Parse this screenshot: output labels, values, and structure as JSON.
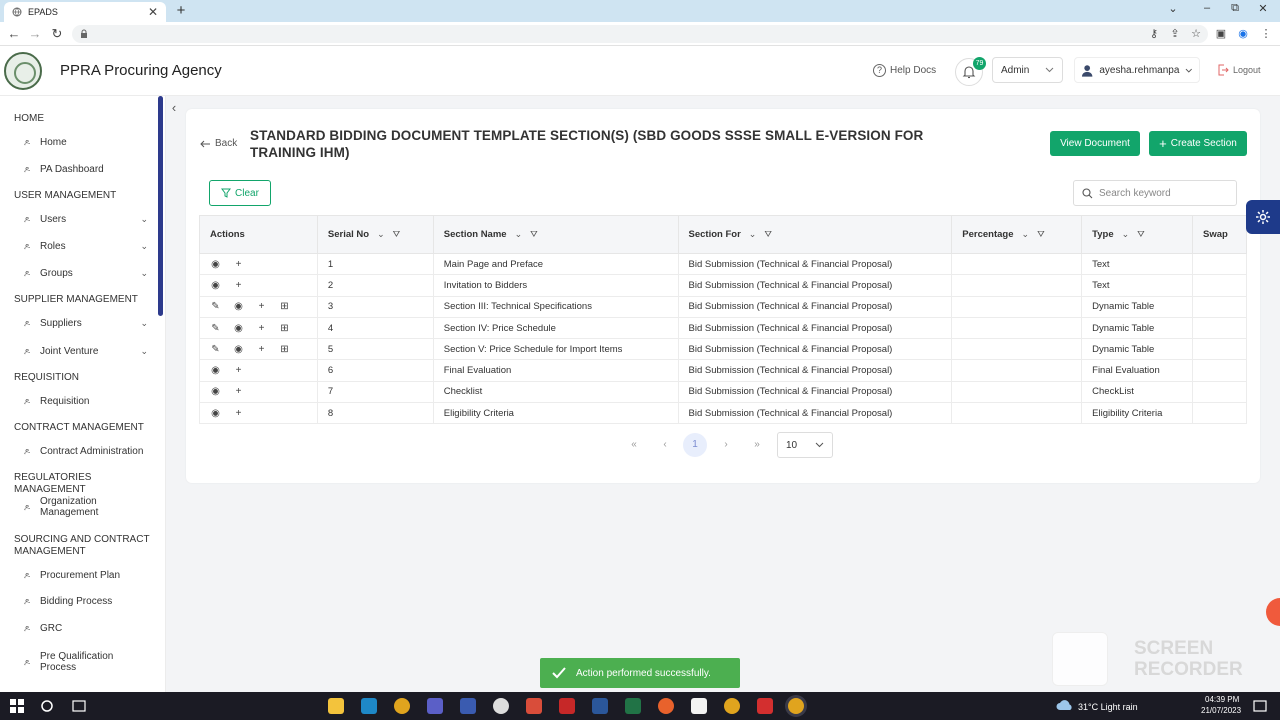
{
  "browser": {
    "tab_title": "EPADS",
    "close_glyph": "✕",
    "newtab_glyph": "+",
    "win_controls": [
      "⌄",
      "–",
      "⧉",
      "✕"
    ],
    "nav_icons": [
      "←",
      "→",
      "↻"
    ],
    "address_icons": [
      "⚷",
      "⇪",
      "☆",
      "▣",
      "◉",
      "⋮"
    ]
  },
  "header": {
    "agency": "PPRA Procuring Agency",
    "help_label": "Help Docs",
    "notification_count": "79",
    "role": "Admin",
    "user": "ayesha.rehmanpa",
    "logout": "Logout"
  },
  "sidebar": {
    "sections": [
      {
        "label": "HOME"
      },
      {
        "label": "USER MANAGEMENT"
      },
      {
        "label": "SUPPLIER MANAGEMENT"
      },
      {
        "label": "REQUISITION"
      },
      {
        "label": "CONTRACT MANAGEMENT"
      },
      {
        "label": "REGULATORIES MANAGEMENT"
      },
      {
        "label": "SOURCING AND CONTRACT MANAGEMENT"
      }
    ],
    "items": [
      {
        "label": "Home"
      },
      {
        "label": "PA Dashboard"
      },
      {
        "label": "Users"
      },
      {
        "label": "Roles"
      },
      {
        "label": "Groups"
      },
      {
        "label": "Suppliers"
      },
      {
        "label": "Joint Venture"
      },
      {
        "label": "Requisition"
      },
      {
        "label": "Contract Administration"
      },
      {
        "label": "Organization Management"
      },
      {
        "label": "Procurement Plan"
      },
      {
        "label": "Bidding Process"
      },
      {
        "label": "GRC"
      },
      {
        "label": "Pre Qualification Process"
      }
    ]
  },
  "page": {
    "back": "Back",
    "title": "STANDARD BIDDING DOCUMENT TEMPLATE SECTION(S) (SBD GOODS SSSE SMALL E-VERSION FOR TRAINING IHM)",
    "view_document": "View Document",
    "create_section": "Create Section",
    "clear": "Clear",
    "search_placeholder": "Search keyword"
  },
  "table": {
    "headers": [
      "Actions",
      "Serial No",
      "Section Name",
      "Section For",
      "Percentage",
      "Type",
      "Swap"
    ],
    "rows": [
      {
        "serial": "1",
        "name": "Main Page and Preface",
        "for": "Bid Submission (Technical & Financial Proposal)",
        "percentage": "",
        "type": "Text"
      },
      {
        "serial": "2",
        "name": "Invitation to Bidders",
        "for": "Bid Submission (Technical & Financial Proposal)",
        "percentage": "",
        "type": "Text"
      },
      {
        "serial": "3",
        "name": "Section III: Technical Specifications",
        "for": "Bid Submission (Technical & Financial Proposal)",
        "percentage": "",
        "type": "Dynamic Table"
      },
      {
        "serial": "4",
        "name": "Section IV: Price Schedule",
        "for": "Bid Submission (Technical & Financial Proposal)",
        "percentage": "",
        "type": "Dynamic Table"
      },
      {
        "serial": "5",
        "name": "Section V: Price Schedule for Import Items",
        "for": "Bid Submission (Technical & Financial Proposal)",
        "percentage": "",
        "type": "Dynamic Table"
      },
      {
        "serial": "6",
        "name": "Final Evaluation",
        "for": "Bid Submission (Technical & Financial Proposal)",
        "percentage": "",
        "type": "Final Evaluation"
      },
      {
        "serial": "7",
        "name": "Checklist",
        "for": "Bid Submission (Technical & Financial Proposal)",
        "percentage": "",
        "type": "CheckList"
      },
      {
        "serial": "8",
        "name": "Eligibility Criteria",
        "for": "Bid Submission (Technical & Financial Proposal)",
        "percentage": "",
        "type": "Eligibility Criteria"
      }
    ]
  },
  "pagination": {
    "first": "«",
    "prev": "‹",
    "current": "1",
    "next": "›",
    "last": "»",
    "page_size": "10"
  },
  "toast": {
    "message": "Action performed successfully."
  },
  "watermark": "SCREEN RECORDER",
  "taskbar": {
    "weather": "31°C  Light rain",
    "time": "04:39 PM",
    "date": "21/07/2023"
  },
  "colors": {
    "primary_green": "#12a56b",
    "sidebar_scroll": "#2d3a8c",
    "gear_tab": "#1e3a8a",
    "toast": "#4caf50"
  }
}
